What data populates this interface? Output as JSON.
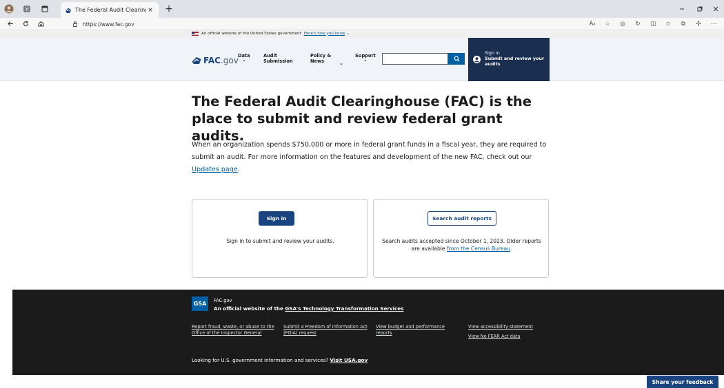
{
  "browser": {
    "tab_title": "The Federal Audit Clearinghouse",
    "url": "https://www.fac.gov",
    "new_tab": "+",
    "tab_close": "×"
  },
  "gov_banner": {
    "text": "An official website of the United States government",
    "how_link": "Here's how you know"
  },
  "header": {
    "logo_fac": "FAC",
    "logo_gov": ".gov",
    "nav": {
      "data": "Data",
      "audit_submission_1": "Audit",
      "audit_submission_2": "Submission",
      "policy_news_1": "Policy &",
      "policy_news_2": "News",
      "support": "Support"
    },
    "search_placeholder": "",
    "signin": {
      "line1": "Sign in",
      "line2": "Submit and review your",
      "line3": "audits"
    }
  },
  "hero": {
    "title": "The Federal Audit Clearinghouse (FAC) is the place to submit and review federal grant audits.",
    "intro": "When an organization spends $750,000 or more in federal grant funds in a fiscal year, they are required to submit an audit. For more information on the features and development of the new FAC, check out our ",
    "updates_link": "Updates page",
    "intro_end": "."
  },
  "cards": {
    "signin": {
      "button": "Sign in",
      "text": "Sign in to submit and review your audits."
    },
    "search": {
      "button": "Search audit reports",
      "text": "Search audits accepted since October 1, 2023. Older reports are available ",
      "link": "from the Census Bureau",
      "text_end": "."
    }
  },
  "footer": {
    "gsa": "GSA",
    "site": "FAC.gov",
    "official_prefix": "An official website of the ",
    "official_link": "GSA's Technology Transformation Services",
    "links": {
      "fraud": "Report fraud, waste, or abuse to the Office of the Inspector General",
      "foia": "Submit a Freedom of Information Act (FOIA) request",
      "budget": "View budget and performance reports",
      "accessibility": "View accessibility statement",
      "nofear": "View No FEAR Act data"
    },
    "usagov_prefix": "Looking for U.S. government information and services? ",
    "usagov_link": "Visit USA.gov"
  },
  "feedback": "Share your feedback",
  "colors": {
    "primary": "#1a4480",
    "link": "#005ea2",
    "header_bg": "#f0f4f9",
    "footer_bg": "#1b1b1b",
    "signin_tile": "#1a2e4f"
  },
  "icons": [
    "avatar-icon",
    "collections-icon",
    "tab-actions-icon",
    "fac-favicon",
    "back-icon",
    "refresh-icon",
    "home-icon",
    "lock-icon",
    "read-aloud-icon",
    "favorite-icon",
    "tracking-icon",
    "update-icon",
    "split-screen-icon",
    "favorites-bar-icon",
    "collections-sidebar-icon",
    "extensions-icon",
    "more-icon",
    "us-flag-icon",
    "fac-logo-icon",
    "search-icon",
    "user-circle-icon"
  ]
}
